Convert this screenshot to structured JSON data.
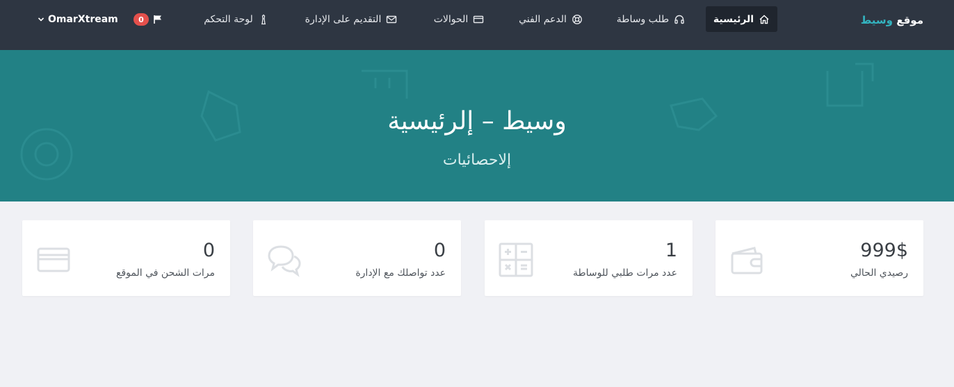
{
  "navbar": {
    "brand": {
      "prefix": "موقع",
      "accent": "وسيط"
    },
    "items": [
      {
        "label": "الرئيسية",
        "icon": "home-icon",
        "active": true
      },
      {
        "label": "طلب وساطة",
        "icon": "headset-icon",
        "active": false
      },
      {
        "label": "الدعم الفني",
        "icon": "lifebuoy-icon",
        "active": false
      },
      {
        "label": "الحوالات",
        "icon": "credit-card-icon",
        "active": false
      },
      {
        "label": "التقديم على الإدارة",
        "icon": "envelope-icon",
        "active": false
      },
      {
        "label": "لوحة التحكم",
        "icon": "chess-icon",
        "active": false
      }
    ],
    "notifications": {
      "count": "0",
      "icon": "flag-icon"
    },
    "user": {
      "name": "OmarXtream",
      "icon": "chevron-down-icon"
    }
  },
  "hero": {
    "title": "وسيط – إلرئيسية",
    "subtitle": "إلاحصائيات"
  },
  "stats": [
    {
      "value": "999$",
      "label": "رصيدي الحالي",
      "icon": "wallet-icon"
    },
    {
      "value": "1",
      "label": "عدد مرات طلبي للوساطة",
      "icon": "calculator-icon"
    },
    {
      "value": "0",
      "label": "عدد تواصلك مع الإدارة",
      "icon": "chat-bubbles-icon"
    },
    {
      "value": "0",
      "label": "مرات الشحن في الموقع",
      "icon": "credit-card-icon"
    }
  ],
  "colors": {
    "navbar": "#2e3642",
    "nav_active": "#1f252e",
    "brand_accent": "#33b4c0",
    "hero": "#228185",
    "badge": "#e4504c",
    "page_bg": "#f0f1f5"
  }
}
